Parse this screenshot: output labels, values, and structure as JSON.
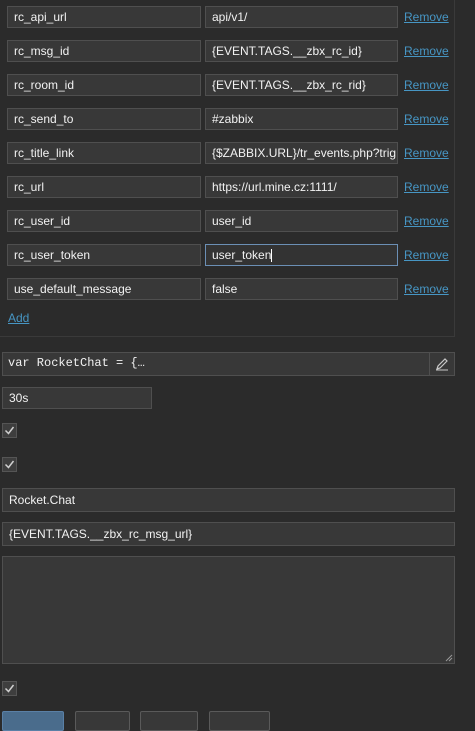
{
  "params": [
    {
      "name": "rc_api_url",
      "value": "api/v1/"
    },
    {
      "name": "rc_msg_id",
      "value": "{EVENT.TAGS.__zbx_rc_id}"
    },
    {
      "name": "rc_room_id",
      "value": "{EVENT.TAGS.__zbx_rc_rid}"
    },
    {
      "name": "rc_send_to",
      "value": "#zabbix"
    },
    {
      "name": "rc_title_link",
      "value": "{$ZABBIX.URL}/tr_events.php?trig"
    },
    {
      "name": "rc_url",
      "value": "https://url.mine.cz:1111/"
    },
    {
      "name": "rc_user_id",
      "value": "user_id"
    },
    {
      "name": "rc_user_token",
      "value": "user_token"
    },
    {
      "name": "use_default_message",
      "value": "false"
    }
  ],
  "remove_label": "Remove",
  "add_label": "Add",
  "script_preview": "var RocketChat = {…",
  "timeout_value": "30s",
  "menu_name": "Rocket.Chat",
  "menu_url": "{EVENT.TAGS.__zbx_rc_msg_url}",
  "description": "",
  "checkboxes": {
    "process_tags": true,
    "include_event_menu": true,
    "enabled": true
  },
  "colors": {
    "link": "#4796c4",
    "background": "#2b2b2b",
    "field": "#383838"
  },
  "icons": {
    "edit": "pencil-icon",
    "check": "check-icon",
    "resize": "resize-grip-icon"
  }
}
